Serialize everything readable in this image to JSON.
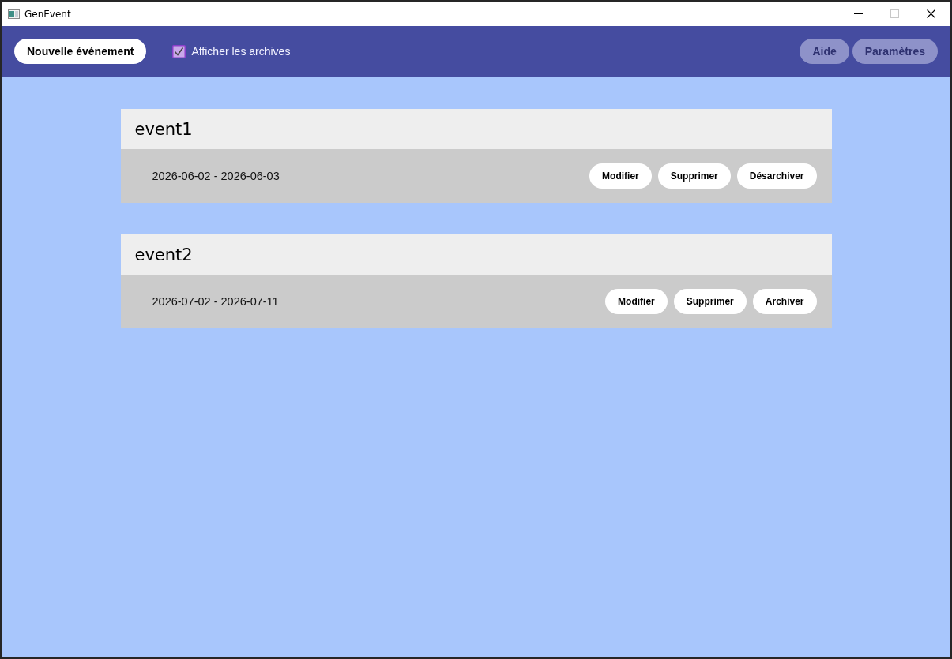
{
  "window": {
    "title": "GenEvent",
    "maximize_disabled": true
  },
  "toolbar": {
    "new_button": "Nouvelle événement",
    "show_archives": {
      "label": "Afficher les archives",
      "checked": true
    },
    "right_buttons": [
      "Aide",
      "Paramètres"
    ]
  },
  "events": [
    {
      "title": "event1",
      "dates": "2026-06-02 - 2026-06-03",
      "actions": [
        "Modifier",
        "Supprimer",
        "Désarchiver"
      ]
    },
    {
      "title": "event2",
      "dates": "2026-07-02 - 2026-07-11",
      "actions": [
        "Modifier",
        "Supprimer",
        "Archiver"
      ]
    }
  ]
}
